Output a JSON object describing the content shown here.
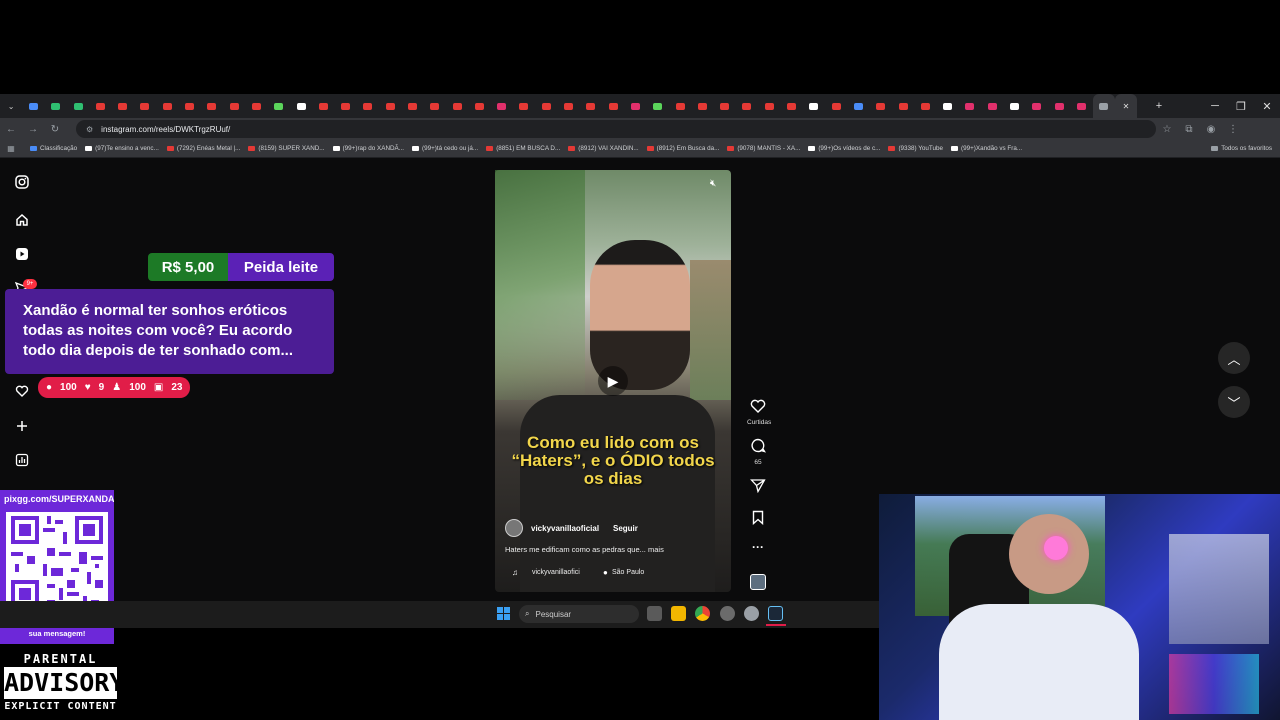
{
  "browser": {
    "url": "instagram.com/reels/DWKTrgzRUuf/",
    "tab_count": 52,
    "tab_colors": [
      "#4a8cf7",
      "#2fbf71",
      "#2fbf71",
      "#e53935",
      "#e53935",
      "#e53935",
      "#e53935",
      "#e53935",
      "#e53935",
      "#e53935",
      "#e53935",
      "#5bd55b",
      "#ffffff",
      "#e53935",
      "#e53935",
      "#e53935",
      "#e53935",
      "#e53935",
      "#e53935",
      "#e53935",
      "#e53935",
      "#e1306c",
      "#e53935",
      "#e53935",
      "#e53935",
      "#e53935",
      "#e53935",
      "#e1306c",
      "#5bd55b",
      "#e53935",
      "#e53935",
      "#e53935",
      "#e53935",
      "#e53935",
      "#e53935",
      "#ffffff",
      "#e53935",
      "#4a8cf7",
      "#e53935",
      "#e53935",
      "#e53935",
      "#ffffff",
      "#e1306c",
      "#e1306c",
      "#ffffff",
      "#e1306c",
      "#e1306c",
      "#e1306c",
      "#9aa0a6"
    ],
    "bookmarks": [
      {
        "label": "Classificação",
        "color": "#4a8cf7"
      },
      {
        "label": "(97)Te ensino a venc...",
        "color": "#ffffff"
      },
      {
        "label": "(7292) Enéas Metal |...",
        "color": "#e53935"
      },
      {
        "label": "(8159) SUPER XAND...",
        "color": "#e53935"
      },
      {
        "label": "(99+)rap do XANDÃ...",
        "color": "#ffffff"
      },
      {
        "label": "(99+)tá cedo ou já...",
        "color": "#ffffff"
      },
      {
        "label": "(8851) EM BUSCA D...",
        "color": "#e53935"
      },
      {
        "label": "(8912) VAI XANDIN...",
        "color": "#e53935"
      },
      {
        "label": "(8912) Em Busca da...",
        "color": "#e53935"
      },
      {
        "label": "(9078) MANTIS - XA...",
        "color": "#e53935"
      },
      {
        "label": "(99+)Os vídeos de c...",
        "color": "#ffffff"
      },
      {
        "label": "(9338) YouTube",
        "color": "#e53935"
      },
      {
        "label": "(99+)Xandão vs Fra...",
        "color": "#ffffff"
      }
    ],
    "all_bookmarks_label": "Todos os favoritos"
  },
  "sidebar": {
    "notification_badge": "9+"
  },
  "reel": {
    "caption_line1": "Como eu lido com os",
    "caption_line2": "“Haters”, e o ÓDIO todos",
    "caption_line3": "os dias",
    "username": "vickyvanillaoficial",
    "follow_label": "Seguir",
    "description": "Haters me edificam como as pedras que... mais",
    "music": "vickyvanillaofici",
    "location": "São Paulo"
  },
  "actions": {
    "likes_label": "Curtidas",
    "comments_count": "65"
  },
  "donation": {
    "amount": "R$ 5,00",
    "name": "Peida leite",
    "message": "Xandão é normal ter sonhos eróticos todas as noites com você? Eu acordo todo dia depois de ter sonhado com..."
  },
  "stats": {
    "comments": "100",
    "likes": "9",
    "followers": "100",
    "subs": "23"
  },
  "donate_qr": {
    "url": "pixgg.com/SUPERXANDA",
    "text": "Fortaleça no donate e envie sua mensagem!"
  },
  "parental_advisory": {
    "line1": "PARENTAL",
    "line2": "ADVISORY",
    "line3": "EXPLICIT CONTENT"
  },
  "taskbar": {
    "search_placeholder": "Pesquisar"
  }
}
